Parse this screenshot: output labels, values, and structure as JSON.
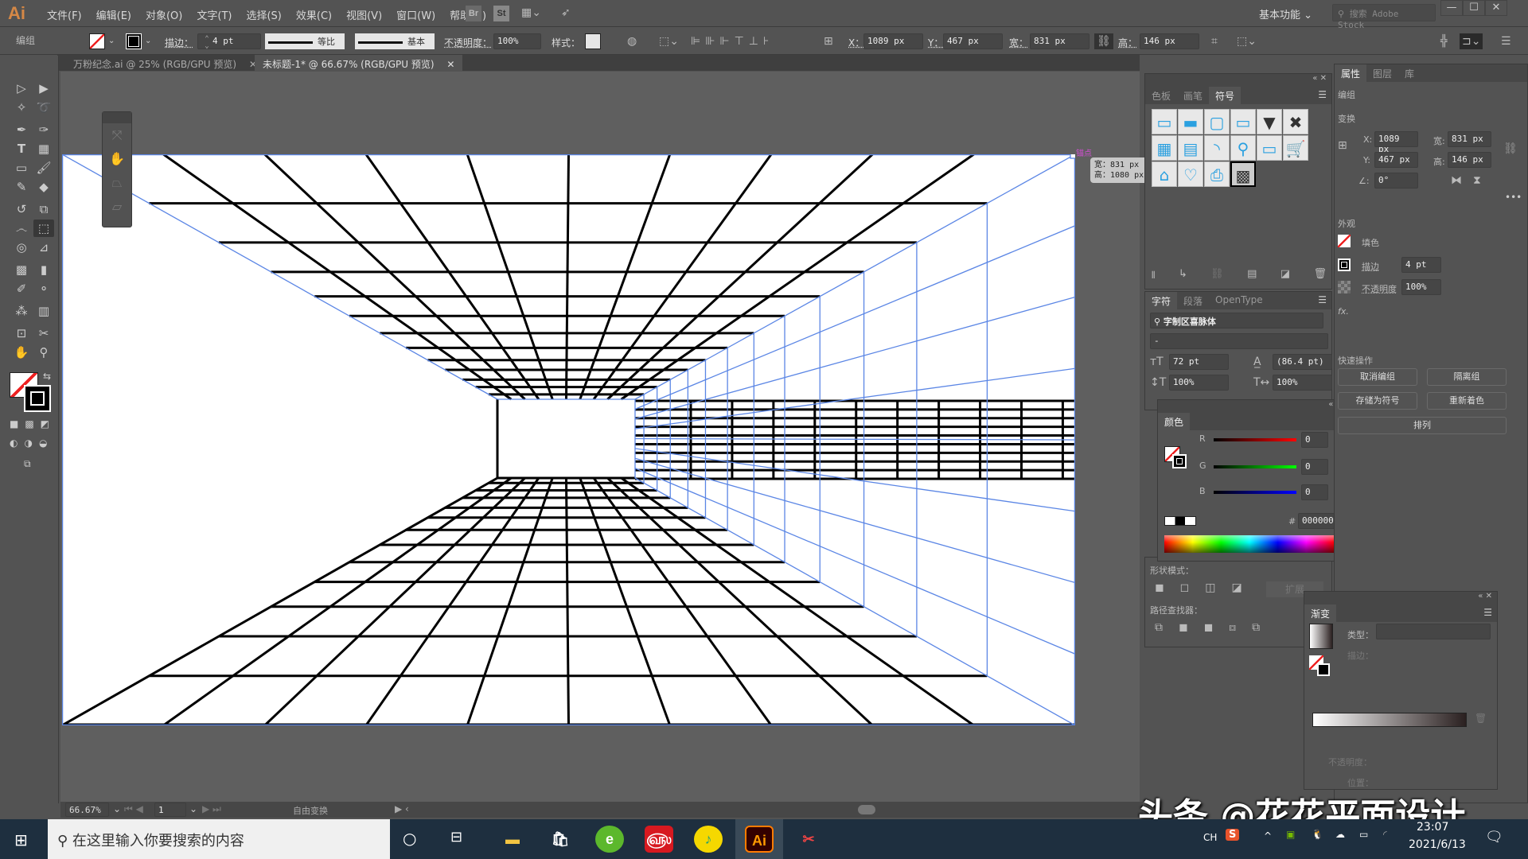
{
  "app": {
    "logo": "Ai",
    "menus": [
      "文件(F)",
      "编辑(E)",
      "对象(O)",
      "文字(T)",
      "选择(S)",
      "效果(C)",
      "视图(V)",
      "窗口(W)",
      "帮助(H)"
    ],
    "bridge_label": "Br",
    "stock_label": "St",
    "workspace": "基本功能",
    "stock_search_placeholder": "搜索 Adobe Stock",
    "win_min": "—",
    "win_max": "☐",
    "win_close": "✕"
  },
  "control": {
    "selection_type": "编组",
    "stroke_label": "描边：",
    "stroke_weight": "4 pt",
    "profile_label": "等比",
    "brush_label": "基本",
    "opacity_label": "不透明度：",
    "opacity": "100%",
    "style_label": "样式：",
    "x_label": "X：",
    "x": "1089 px",
    "y_label": "Y：",
    "y": "467 px",
    "w_label": "宽：",
    "w": "831 px",
    "h_label": "高：",
    "h": "146 px"
  },
  "tabs": [
    {
      "label": "万粉纪念.ai @ 25% (RGB/GPU 预览)",
      "active": false
    },
    {
      "label": "未标题-1* @ 66.67% (RGB/GPU 预览)",
      "active": true
    }
  ],
  "canvas": {
    "anchor_label": "锚点",
    "tooltip_w": "宽：831 px",
    "tooltip_h": "高：1080 px",
    "stroke_color": "#000000",
    "guide_color": "#5b86e5"
  },
  "status": {
    "zoom": "66.67%",
    "page": "1",
    "tool": "自由变换"
  },
  "symbols_panel": {
    "tabs": [
      "色板",
      "画笔",
      "符号"
    ],
    "active": "符号",
    "symbols": [
      "button-blank",
      "button-gradient",
      "button-light",
      "dropdown-bar",
      "dropdown-arrow",
      "close-x",
      "calendar",
      "film",
      "rss",
      "search",
      "credit-card",
      "cart",
      "home",
      "heart-plus",
      "printer",
      "grid-pattern"
    ]
  },
  "properties_panel": {
    "tabs": [
      "属性",
      "图层",
      "库"
    ],
    "group": "编组",
    "transform": "变换",
    "x": "1089 px",
    "y": "467 px",
    "w": "831 px",
    "h": "146 px",
    "angle": "0°",
    "appearance": "外观",
    "fill": "填色",
    "stroke": "描边",
    "stroke_weight": "4 pt",
    "opacity_label": "不透明度",
    "opacity": "100%",
    "fx": "fx.",
    "quick_actions": "快速操作",
    "buttons": [
      "取消编组",
      "隔离组",
      "存储为符号",
      "重新着色",
      "排列"
    ]
  },
  "character_panel": {
    "tabs": [
      "字符",
      "段落",
      "OpenType"
    ],
    "font": "字制区喜脉体",
    "style": "-",
    "size": "72 pt",
    "leading": "(86.4 pt)",
    "vscale": "100%",
    "hscale": "100%"
  },
  "color_panel": {
    "title": "颜色",
    "r": "0",
    "g": "0",
    "b": "0",
    "hex": "000000"
  },
  "pathfinder_panel": {
    "shape_modes": "形状模式：",
    "expand": "扩展",
    "pathfinders": "路径查找器："
  },
  "gradient_panel": {
    "title": "渐变",
    "type_label": "类型：",
    "stroke_label": "描边：",
    "opacity_label": "不透明度：",
    "location_label": "位置："
  },
  "taskbar": {
    "search_placeholder": "在这里输入你要搜索的内容",
    "ime": "CH",
    "time": "23:07",
    "date": "2021/6/13"
  },
  "watermark": "头条 @花花平面设计"
}
